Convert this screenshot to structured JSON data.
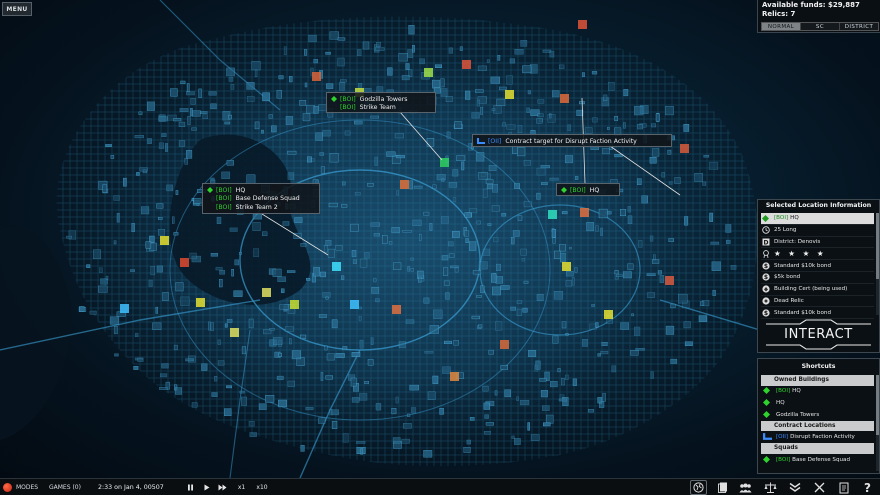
{
  "top_left": {
    "menu_label": "MENU"
  },
  "funds": {
    "available_funds": "Available funds: $29,887",
    "relics": "Relics: 7",
    "tabs": [
      {
        "label": "NORMAL",
        "active": true
      },
      {
        "label": "SC",
        "active": false
      },
      {
        "label": "DISTRICT",
        "active": false
      }
    ]
  },
  "tooltips": {
    "godzilla": {
      "rows": [
        {
          "tag": "[BOI]",
          "label": "Godzilla Towers"
        },
        {
          "tag": "[BOI]",
          "label": "Strike Team"
        }
      ]
    },
    "contract": {
      "rows": [
        {
          "tag": "[OII]",
          "label": "Contract target for Disrupt Faction Activity"
        }
      ]
    },
    "hq_right": {
      "rows": [
        {
          "tag": "[BOI]",
          "label": "HQ"
        }
      ]
    },
    "hq_left": {
      "rows": [
        {
          "tag": "[BOI]",
          "label": "HQ"
        },
        {
          "tag": "[BOI]",
          "label": "Base Defense Squad"
        },
        {
          "tag": "[BOI]",
          "label": "Strike Team 2"
        }
      ]
    }
  },
  "info_panel": {
    "title": "Selected Location Information",
    "rows": [
      {
        "tag": "[BOI]",
        "label": "HQ",
        "icon": "diamond-icon"
      },
      {
        "label": "25 Long",
        "icon": "clock-icon"
      },
      {
        "label": "District: Denovis",
        "icon": "district-icon"
      },
      {
        "label": "★ ★ ★ ★",
        "icon": "rating-icon"
      },
      {
        "label": "Standard $10k bond",
        "icon": "money-icon"
      },
      {
        "label": "$5k bond",
        "icon": "money-icon"
      },
      {
        "label": "Building Cert (being used)",
        "icon": "cert-icon"
      },
      {
        "label": "Dead Relic",
        "icon": "relic-icon"
      },
      {
        "label": "Standard $10k bond",
        "icon": "money-icon"
      }
    ],
    "interact_label": "INTERACT"
  },
  "shortcuts": {
    "title": "Shortcuts",
    "owned_buildings": "Owned Buildings",
    "owned_rows": [
      {
        "tag": "[BOI]",
        "label": "HQ"
      },
      {
        "tag": "",
        "label": "HQ"
      },
      {
        "tag": "",
        "label": "Godzilla Towers"
      }
    ],
    "contract_locations": "Contract Locations",
    "contract_rows": [
      {
        "tag": "[OII]",
        "label": "Disrupt Faction Activity"
      }
    ],
    "squads": "Squads",
    "squad_rows": [
      {
        "tag": "[BOI]",
        "label": "Base Defense Squad"
      }
    ]
  },
  "bottom_bar": {
    "modes_label": "MODES",
    "games_label": "GAMES (0)",
    "time": "2:33 on Jan 4, 00507",
    "speed_1": "x1",
    "speed_10": "x10"
  },
  "colors": {
    "owned_green": "#2ed32e",
    "contract_blue": "#3b8cff",
    "map_glow": "#1e6f9a"
  }
}
